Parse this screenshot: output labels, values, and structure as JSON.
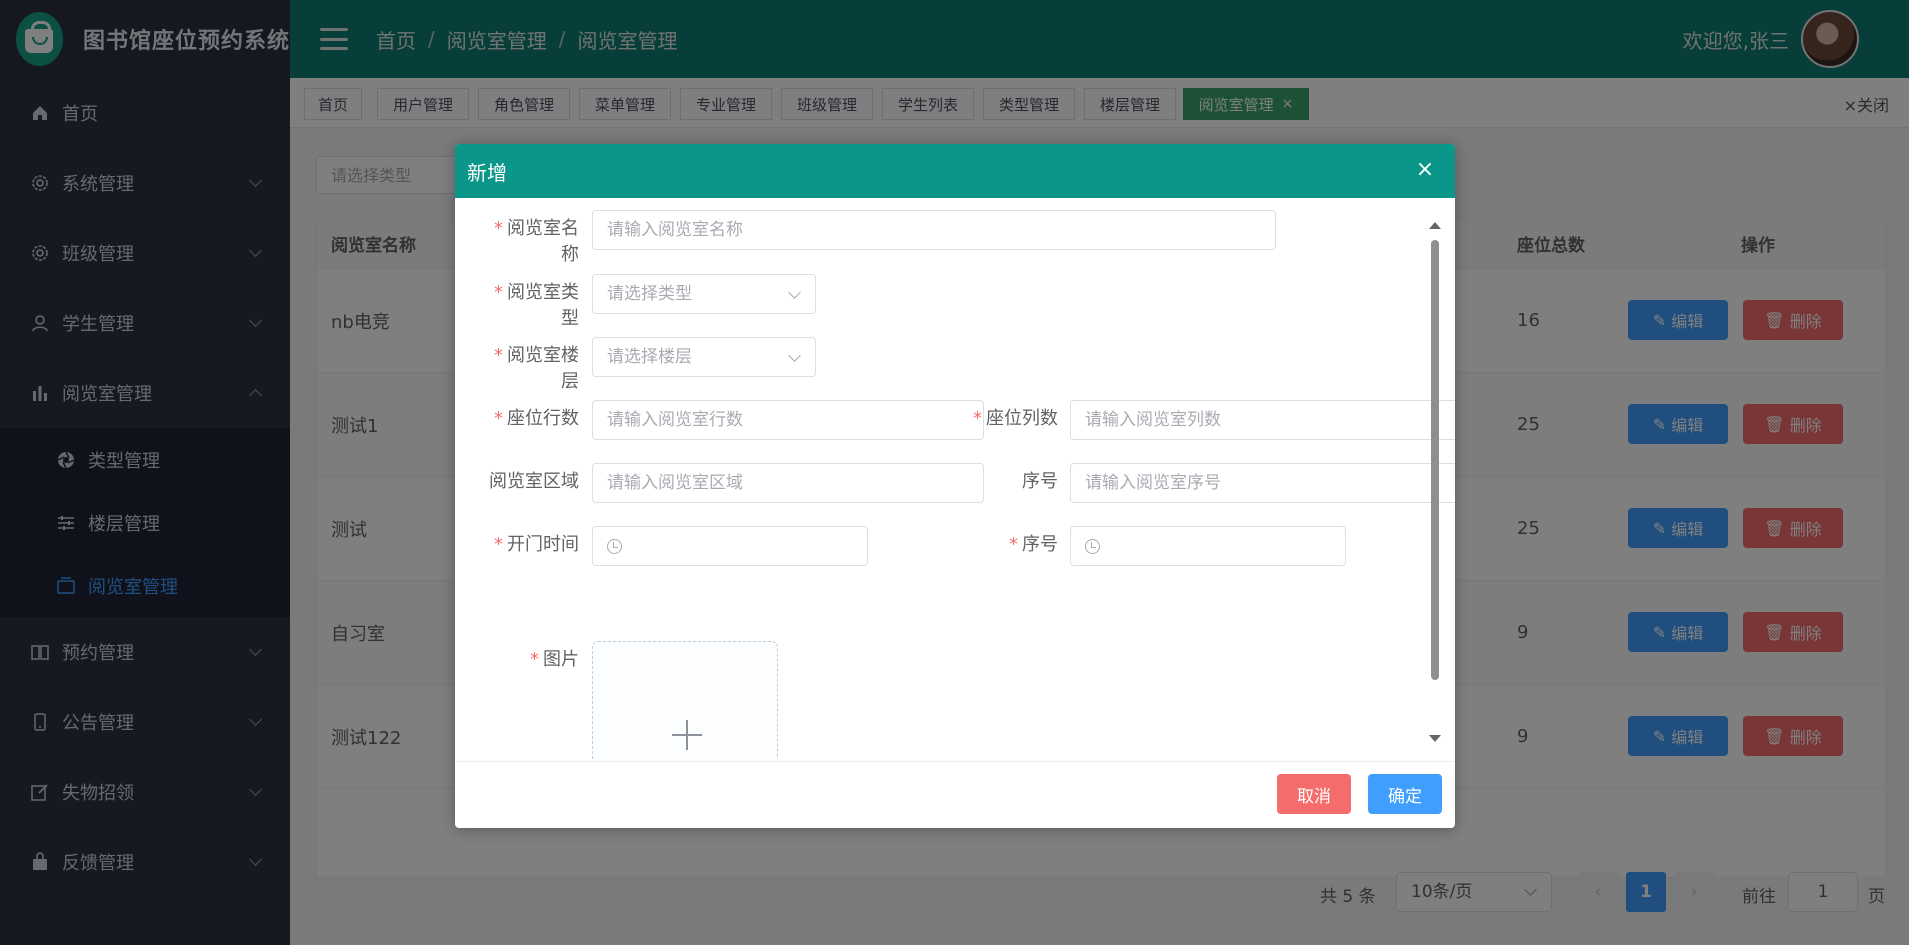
{
  "app": {
    "title": "图书馆座位预约系统"
  },
  "sidebar": {
    "items": [
      {
        "label": "首页",
        "icon": "home-icon"
      },
      {
        "label": "系统管理",
        "icon": "gear-icon"
      },
      {
        "label": "班级管理",
        "icon": "gear-icon"
      },
      {
        "label": "学生管理",
        "icon": "user-icon"
      },
      {
        "label": "阅览室管理",
        "icon": "bar-chart-icon"
      },
      {
        "label": "预约管理",
        "icon": "book-icon"
      },
      {
        "label": "公告管理",
        "icon": "phone-icon"
      },
      {
        "label": "失物招领",
        "icon": "edit-icon"
      },
      {
        "label": "反馈管理",
        "icon": "bag-icon"
      }
    ],
    "submenu": [
      {
        "label": "类型管理",
        "icon": "aperture-icon"
      },
      {
        "label": "楼层管理",
        "icon": "sliders-icon"
      },
      {
        "label": "阅览室管理",
        "icon": "window-icon"
      }
    ]
  },
  "header": {
    "breadcrumb": [
      "首页",
      "阅览室管理",
      "阅览室管理"
    ],
    "welcome": "欢迎您,张三"
  },
  "tabs": [
    "首页",
    "用户管理",
    "角色管理",
    "菜单管理",
    "专业管理",
    "班级管理",
    "学生列表",
    "类型管理",
    "楼层管理",
    "阅览室管理"
  ],
  "tabs_close": "关闭",
  "filter": {
    "placeholder": "请选择类型"
  },
  "table": {
    "headers": {
      "name": "阅览室名称",
      "seats": "座位总数",
      "ops": "操作"
    },
    "rows": [
      {
        "name": "nb电竞",
        "seats": "16"
      },
      {
        "name": "测试1",
        "seats": "25"
      },
      {
        "name": "测试",
        "seats": "25"
      },
      {
        "name": "自习室",
        "seats": "9"
      },
      {
        "name": "测试122",
        "seats": "9"
      }
    ],
    "edit_label": "编辑",
    "delete_label": "删除"
  },
  "pagination": {
    "total": "共 5 条",
    "page_size": "10条/页",
    "current": "1",
    "goto": "前往",
    "goto_value": "1",
    "page_suffix": "页"
  },
  "dialog": {
    "title": "新增",
    "fields": {
      "name": {
        "label": "阅览室名称",
        "placeholder": "请输入阅览室名称"
      },
      "type": {
        "label": "阅览室类型",
        "placeholder": "请选择类型"
      },
      "floor": {
        "label": "阅览室楼层",
        "placeholder": "请选择楼层"
      },
      "rows": {
        "label": "座位行数",
        "placeholder": "请输入阅览室行数"
      },
      "cols": {
        "label": "座位列数",
        "placeholder": "请输入阅览室列数"
      },
      "area": {
        "label": "阅览室区域",
        "placeholder": "请输入阅览室区域"
      },
      "order": {
        "label": "序号",
        "placeholder": "请输入阅览室序号"
      },
      "open_time": {
        "label": "开门时间"
      },
      "order2": {
        "label": "序号"
      },
      "image": {
        "label": "图片"
      }
    },
    "cancel_label": "取消",
    "ok_label": "确定"
  },
  "colors": {
    "header": "#0e7c73",
    "dialog_header": "#0a9688",
    "primary": "#409eff",
    "danger": "#f56c6c",
    "active_tab": "#3aa36a"
  }
}
